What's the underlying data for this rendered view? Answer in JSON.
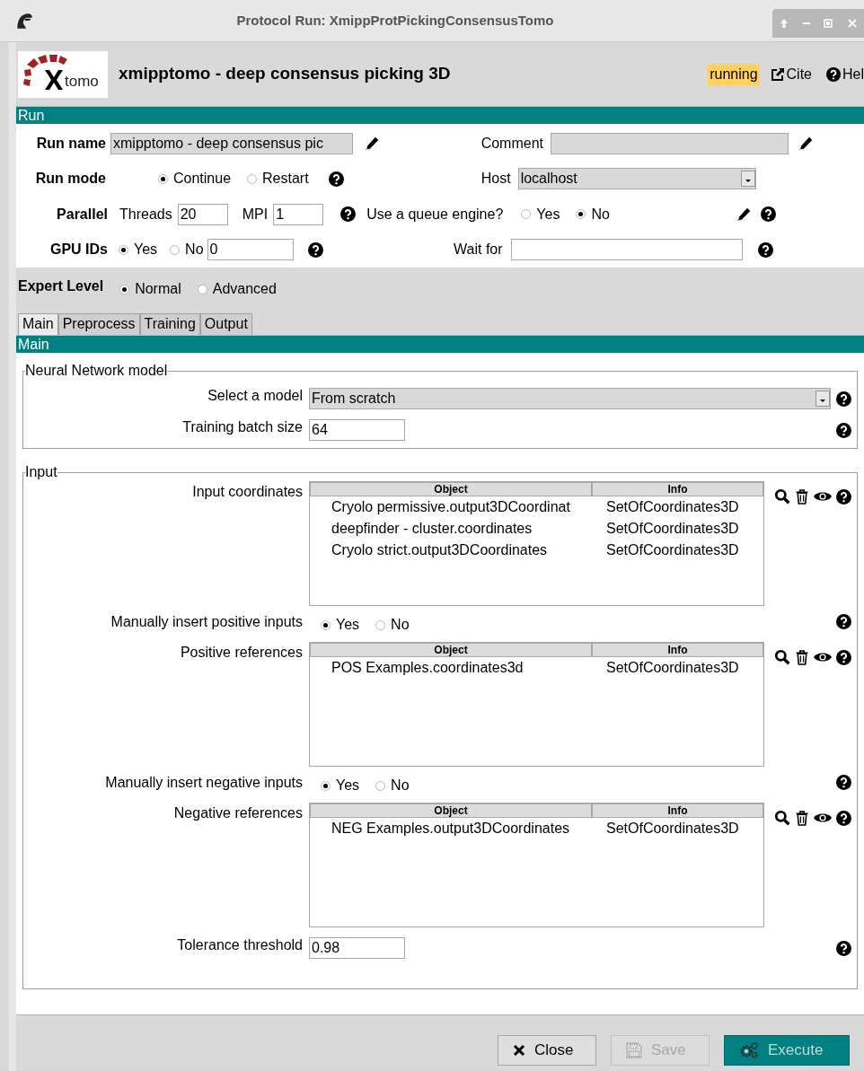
{
  "window": {
    "title": "Protocol Run: XmippProtPickingConsensusTomo"
  },
  "header": {
    "logo_text": "tomo",
    "title": "xmipptomo - deep consensus picking 3D",
    "status": "running",
    "links": [
      {
        "kind": "cite",
        "label": "Cite"
      },
      {
        "kind": "help",
        "label": "Hel"
      }
    ]
  },
  "run_section": {
    "title": "Run",
    "run_name": {
      "label": "Run name",
      "value": "xmipptomo - deep consensus pic"
    },
    "comment": {
      "label": "Comment"
    },
    "run_mode": {
      "label": "Run mode",
      "options": [
        {
          "label": "Continue",
          "selected": true
        },
        {
          "label": "Restart",
          "selected": false
        }
      ]
    },
    "host": {
      "label": "Host",
      "value": "localhost"
    },
    "parallel": {
      "label": "Parallel",
      "threads_label": "Threads",
      "threads": "20",
      "mpi_label": "MPI",
      "mpi": "1"
    },
    "queue": {
      "label": "Use a queue engine?",
      "options": [
        {
          "label": "Yes",
          "selected": false
        },
        {
          "label": "No",
          "selected": true
        }
      ]
    },
    "gpu": {
      "label": "GPU IDs",
      "options": [
        {
          "label": "Yes",
          "selected": true
        },
        {
          "label": "No",
          "selected": false
        }
      ],
      "value": "0"
    },
    "wait_for": {
      "label": "Wait for"
    }
  },
  "expert_level": {
    "label": "Expert Level",
    "options": [
      {
        "label": "Normal",
        "selected": true
      },
      {
        "label": "Advanced",
        "selected": false
      }
    ]
  },
  "tabs": [
    {
      "label": "Main",
      "selected": true
    },
    {
      "label": "Preprocess",
      "selected": false
    },
    {
      "label": "Training",
      "selected": false
    },
    {
      "label": "Output",
      "selected": false
    }
  ],
  "section_title": "Main",
  "groups": [
    {
      "title": "Neural Network model",
      "params": [
        {
          "kind": "select",
          "label": "Select a model",
          "value": "From scratch"
        },
        {
          "kind": "text",
          "label": "Training batch size",
          "value": "64"
        }
      ]
    },
    {
      "title": "Input",
      "params": [
        {
          "kind": "list",
          "label": "Input coordinates",
          "columns": [
            "Object",
            "Info"
          ],
          "rows": [
            [
              "Cryolo permissive.output3DCoordinat",
              "SetOfCoordinates3D"
            ],
            [
              "deepfinder - cluster.coordinates",
              "SetOfCoordinates3D"
            ],
            [
              "Cryolo strict.output3DCoordinates",
              "SetOfCoordinates3D"
            ]
          ]
        },
        {
          "kind": "radio",
          "label": "Manually insert positive inputs",
          "options": [
            {
              "label": "Yes",
              "selected": true
            },
            {
              "label": "No",
              "selected": false
            }
          ]
        },
        {
          "kind": "list",
          "label": "Positive references",
          "columns": [
            "Object",
            "Info"
          ],
          "rows": [
            [
              "POS Examples.coordinates3d",
              "SetOfCoordinates3D"
            ]
          ]
        },
        {
          "kind": "radio",
          "label": "Manually insert negative inputs",
          "options": [
            {
              "label": "Yes",
              "selected": true
            },
            {
              "label": "No",
              "selected": false
            }
          ]
        },
        {
          "kind": "list",
          "label": "Negative references",
          "columns": [
            "Object",
            "Info"
          ],
          "rows": [
            [
              "NEG Examples.output3DCoordinates",
              "SetOfCoordinates3D"
            ]
          ]
        },
        {
          "kind": "text",
          "label": "Tolerance threshold",
          "value": "0.98"
        }
      ]
    }
  ],
  "buttons": [
    {
      "kind": "close",
      "label": "Close",
      "disabled": false
    },
    {
      "kind": "save",
      "label": "Save",
      "disabled": true
    },
    {
      "kind": "execute",
      "label": "Execute",
      "disabled": false
    }
  ]
}
